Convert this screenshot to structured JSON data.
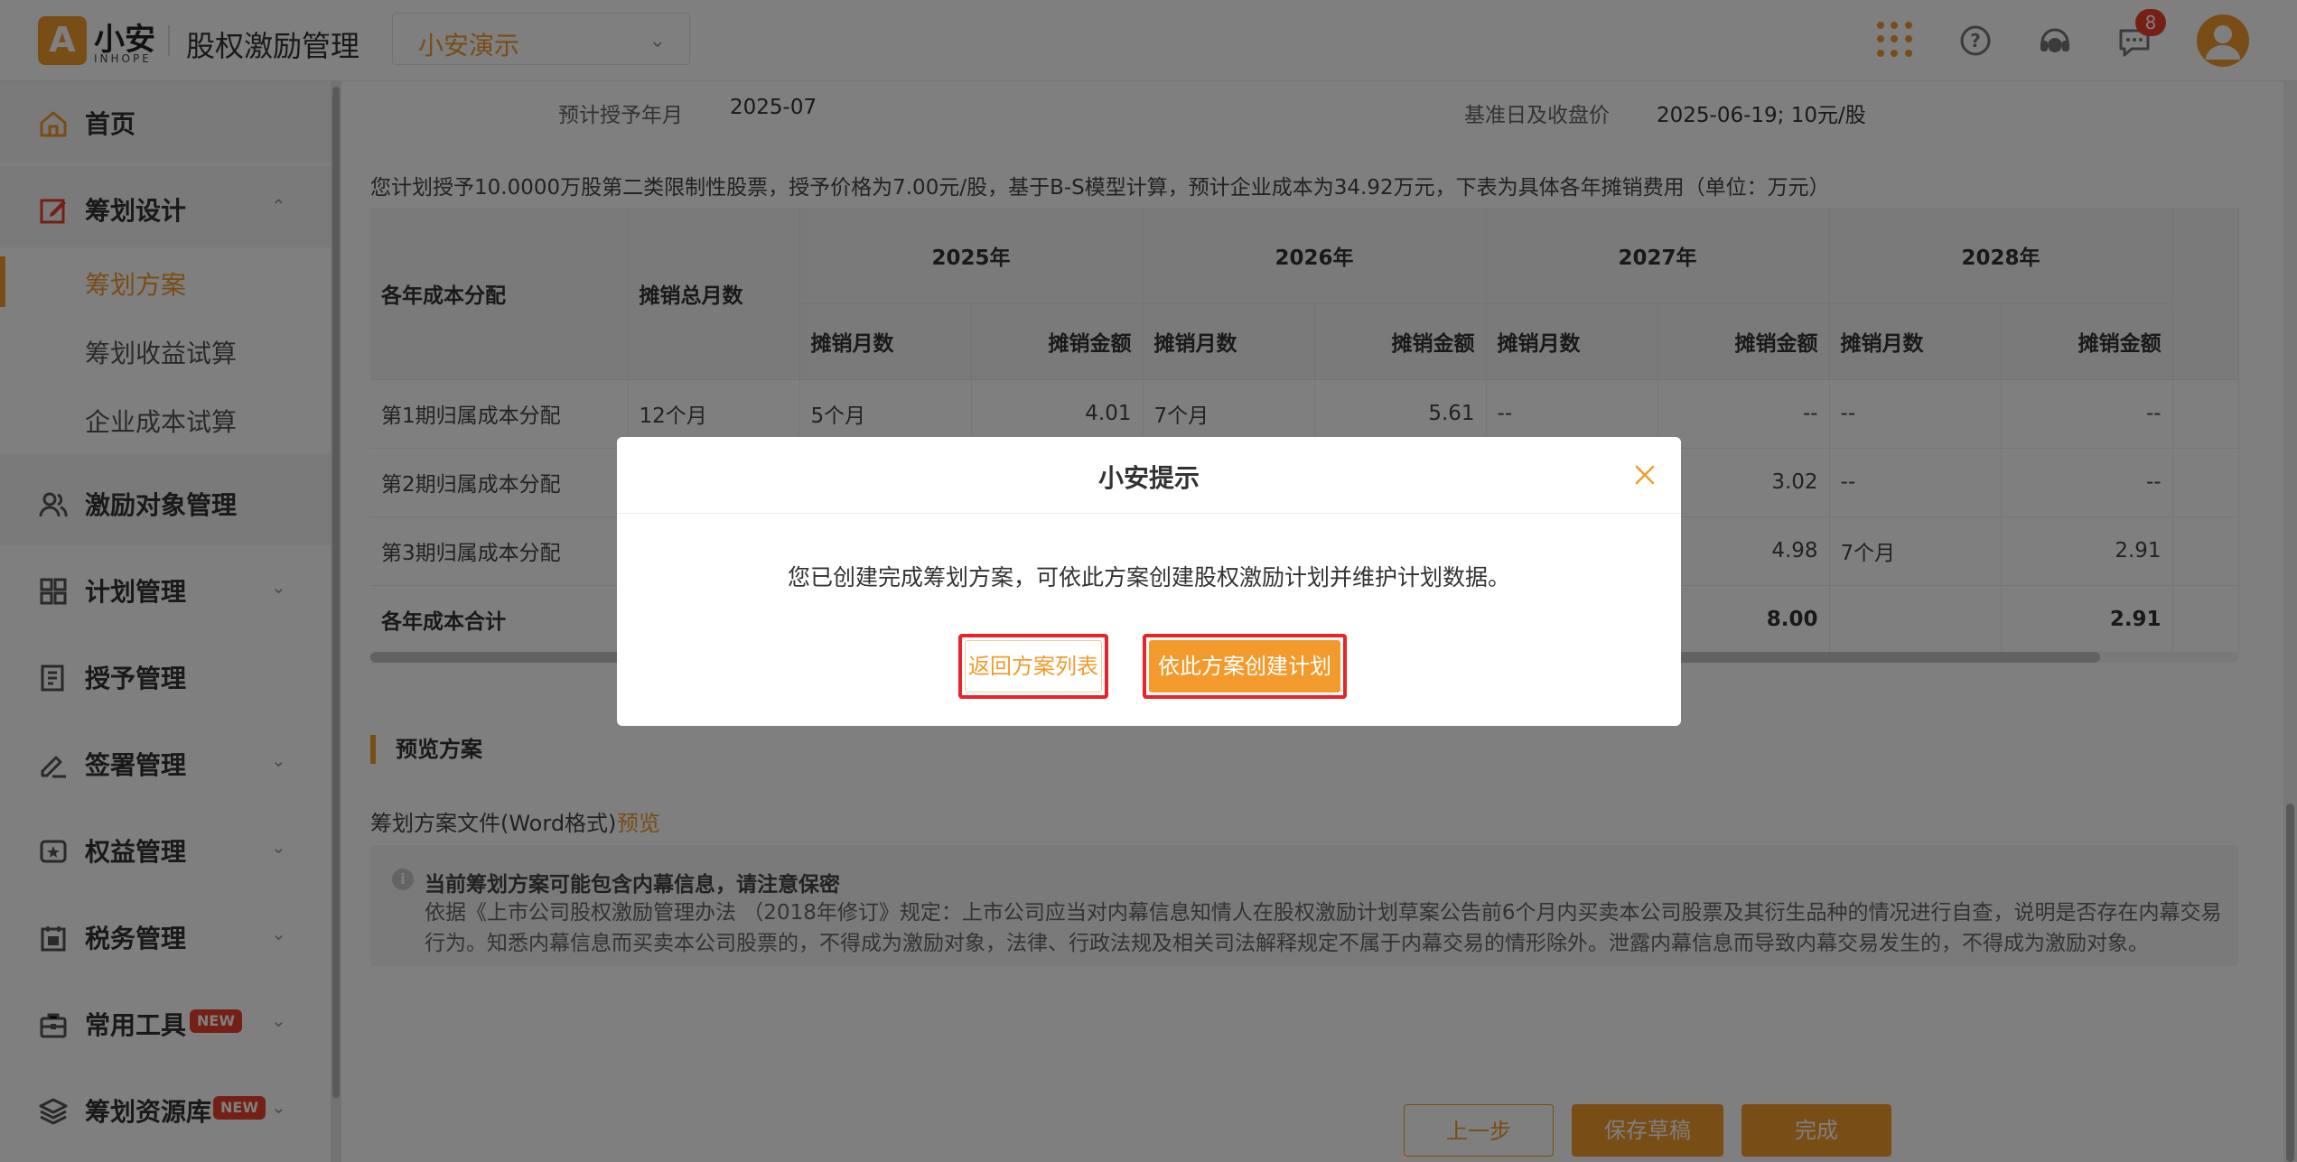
{
  "header": {
    "logo_letter": "A",
    "brand_name": "小安",
    "brand_sub": "INHOPE",
    "app_title": "股权激励管理",
    "org_select": "小安演示",
    "notification_count": "8"
  },
  "sidebar": {
    "home": "首页",
    "planning": "筹划设计",
    "planning_sub": [
      "筹划方案",
      "筹划收益试算",
      "企业成本试算"
    ],
    "incentive_objects": "激励对象管理",
    "plan_mgmt": "计划管理",
    "grant_mgmt": "授予管理",
    "sign_mgmt": "签署管理",
    "equity_mgmt": "权益管理",
    "tax_mgmt": "税务管理",
    "tools": "常用工具",
    "resources": "筹划资源库",
    "new_tag": "NEW"
  },
  "main": {
    "grant_date_label": "预计授予年月",
    "grant_date_value": "2025-07",
    "base_label": "基准日及收盘价",
    "base_value": "2025-06-19; 10元/股",
    "description": "您计划授予10.0000万股第二类限制性股票，授予价格为7.00元/股，基于B-S模型计算，预计企业成本为34.92万元，下表为具体各年摊销费用（单位：万元）",
    "table": {
      "col_alloc": "各年成本分配",
      "col_total_months": "摊销总月数",
      "years": [
        "2025年",
        "2026年",
        "2027年",
        "2028年"
      ],
      "sub_months": "摊销月数",
      "sub_amount": "摊销金额",
      "rows": [
        {
          "label": "第1期归属成本分配",
          "total": "12个月",
          "m2025": "5个月",
          "a2025": "4.01",
          "m2026": "7个月",
          "a2026": "5.61",
          "m2027": "--",
          "a2027": "--",
          "m2028": "--",
          "a2028": "--"
        },
        {
          "label": "第2期归属成本分配",
          "total": "",
          "m2025": "",
          "a2025": "",
          "m2026": "",
          "a2026": "",
          "m2027": "",
          "a2027": "3.02",
          "m2028": "--",
          "a2028": "--"
        },
        {
          "label": "第3期归属成本分配",
          "total": "",
          "m2025": "",
          "a2025": "",
          "m2026": "",
          "a2026": "",
          "m2027": "",
          "a2027": "4.98",
          "m2028": "7个月",
          "a2028": "2.91"
        }
      ],
      "total_row": {
        "label": "各年成本合计",
        "a2027": "8.00",
        "a2028": "2.91"
      }
    },
    "preview_section_title": "预览方案",
    "file_label": "筹划方案文件(Word格式)",
    "preview_link": "预览",
    "notice_title": "当前筹划方案可能包含内幕信息，请注意保密",
    "notice_body": "依据《上市公司股权激励管理办法 （2018年修订》规定：上市公司应当对内幕信息知情人在股权激励计划草案公告前6个月内买卖本公司股票及其衍生品种的情况进行自查，说明是否存在内幕交易行为。知悉内幕信息而买卖本公司股票的，不得成为激励对象，法律、行政法规及相关司法解释规定不属于内幕交易的情形除外。泄露内幕信息而导致内幕交易发生的，不得成为激励对象。",
    "btn_prev": "上一步",
    "btn_draft": "保存草稿",
    "btn_done": "完成"
  },
  "modal": {
    "title": "小安提示",
    "message": "您已创建完成筹划方案，可依此方案创建股权激励计划并维护计划数据。",
    "btn_back": "返回方案列表",
    "btn_create": "依此方案创建计划"
  },
  "colors": {
    "accent": "#f29b2c",
    "highlight": "#e8232b",
    "badge": "#e8412c"
  }
}
